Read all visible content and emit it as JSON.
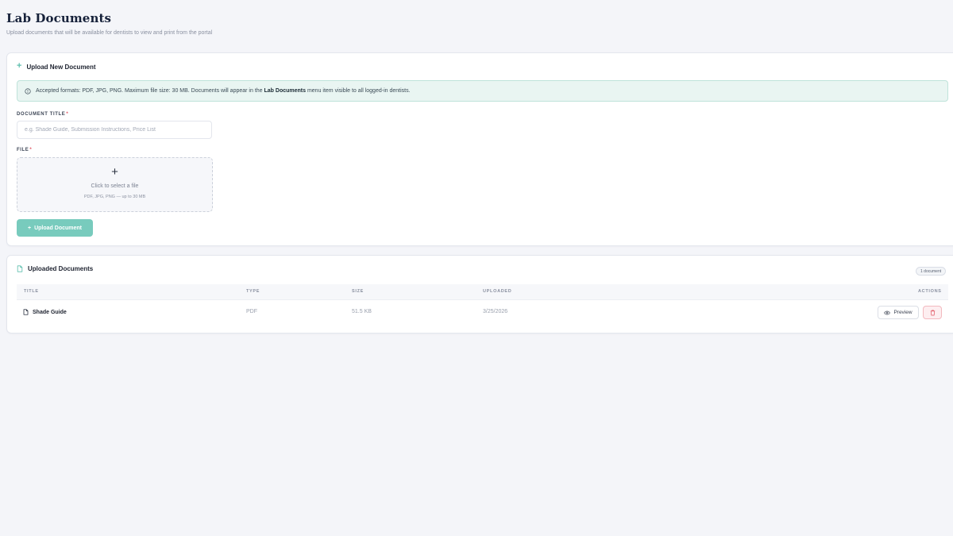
{
  "page": {
    "title": "Lab Documents",
    "subtitle": "Upload documents that will be available for dentists to view and print from the portal"
  },
  "upload": {
    "heading": "Upload New Document",
    "info": {
      "prefix": "Accepted formats: PDF, JPG, PNG. Maximum file size: 30 MB. Documents will appear in the ",
      "highlight": "Lab Documents",
      "suffix": " menu item visible to all logged-in dentists."
    },
    "title_field": {
      "label": "DOCUMENT TITLE",
      "required_mark": "*",
      "placeholder": "e.g. Shade Guide, Submission Instructions, Price List",
      "value": ""
    },
    "file_field": {
      "label": "FILE",
      "required_mark": "*",
      "plus": "+",
      "prompt": "Click to select a file",
      "hint": "PDF, JPG, PNG — up to 30 MB"
    },
    "button_plus": "+",
    "button_label": "Upload Document"
  },
  "documents": {
    "heading": "Uploaded Documents",
    "count_badge": "1 document",
    "columns": {
      "title": "TITLE",
      "type": "TYPE",
      "size": "SIZE",
      "uploaded": "UPLOADED",
      "actions": "ACTIONS"
    },
    "rows": [
      {
        "title": "Shade Guide",
        "type": "PDF",
        "size": "51.5 KB",
        "uploaded": "3/25/2026",
        "preview_label": "Preview"
      }
    ]
  },
  "icons": {
    "info": "info-circle-icon",
    "plus": "plus-icon",
    "document": "document-icon",
    "eye": "eye-icon",
    "trash": "trash-icon"
  },
  "colors": {
    "accent": "#78cbbd",
    "accent_icon": "#5fbfae",
    "info_bg": "#e9f5f2",
    "danger": "#e0525f",
    "background": "#f4f5f9"
  }
}
